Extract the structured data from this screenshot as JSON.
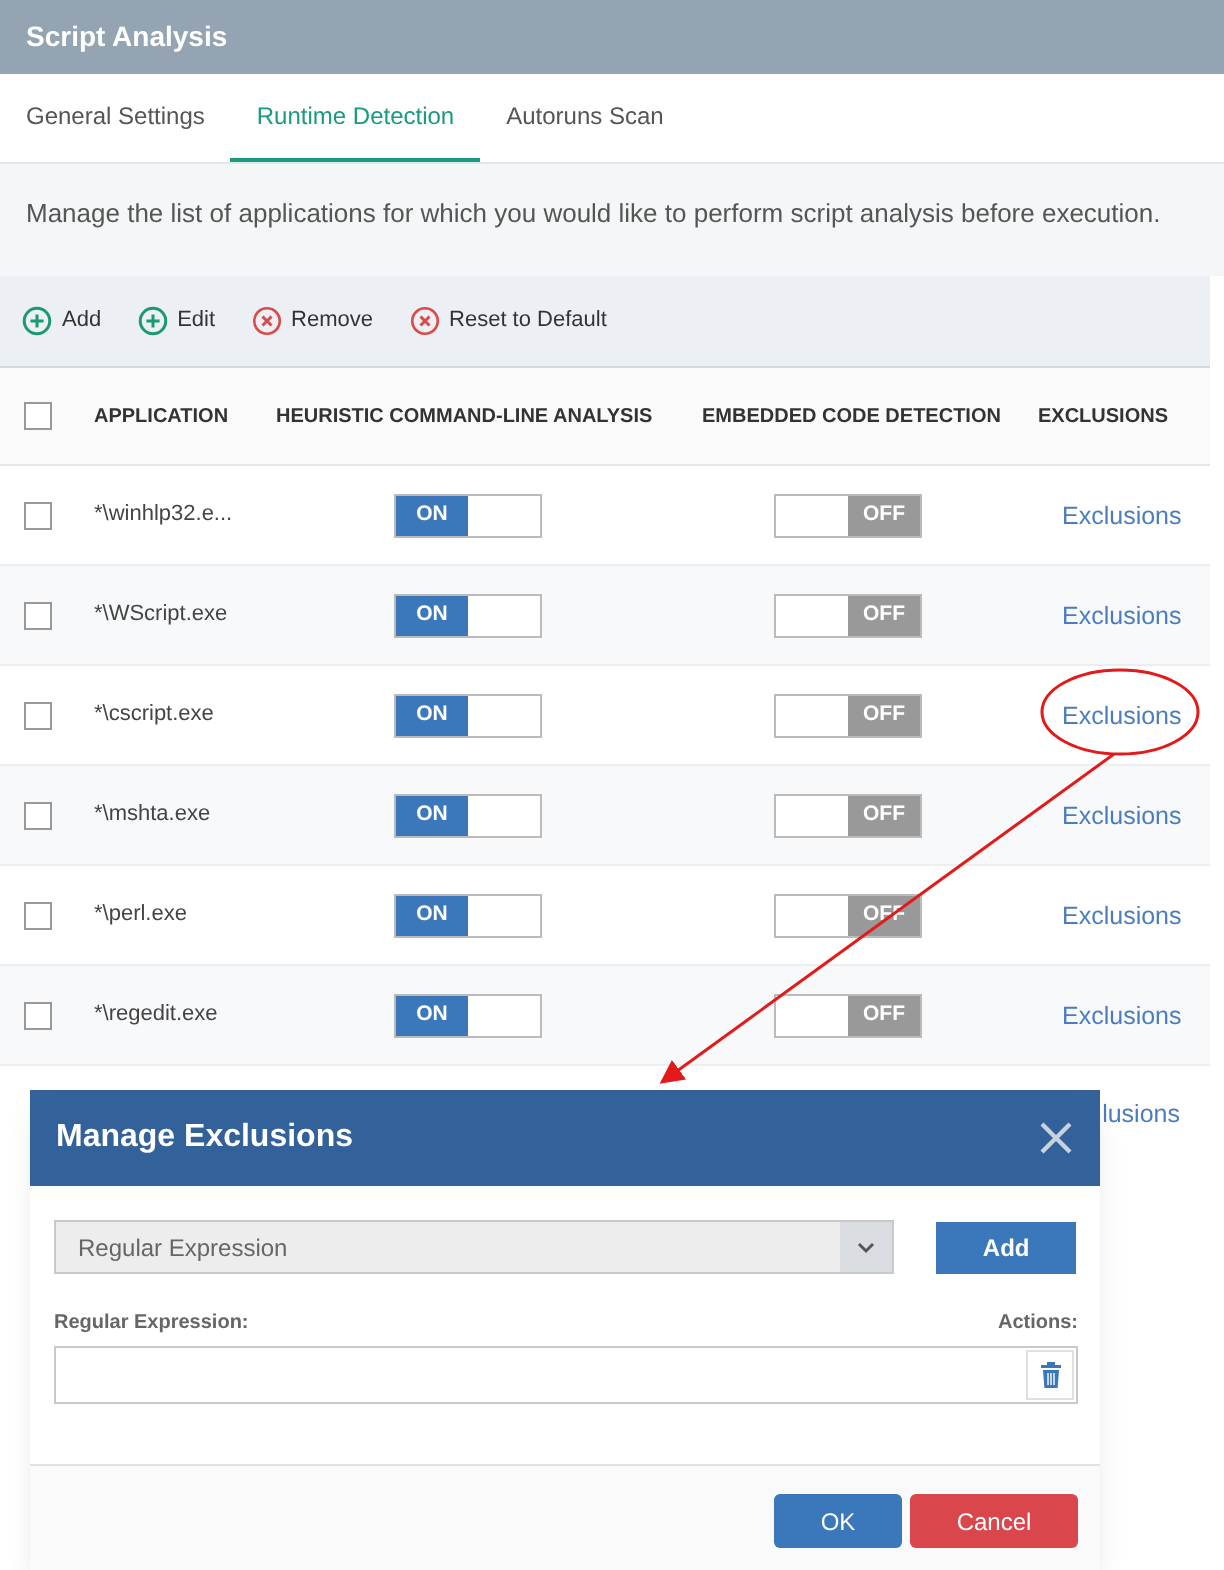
{
  "window": {
    "title": "Script Analysis"
  },
  "tabs": [
    {
      "label": "General Settings",
      "selected": false
    },
    {
      "label": "Runtime Detection",
      "selected": true
    },
    {
      "label": "Autoruns Scan",
      "selected": false
    }
  ],
  "description": "Manage the list of applications for which you would like to perform script analysis before execution.",
  "toolbar": [
    {
      "label": "Add",
      "kind": "add"
    },
    {
      "label": "Edit",
      "kind": "add"
    },
    {
      "label": "Remove",
      "kind": "remove"
    },
    {
      "label": "Reset to Default",
      "kind": "remove"
    }
  ],
  "table": {
    "select_all": {
      "checked": false
    },
    "columns": [
      "APPLICATION",
      "HEURISTIC COMMAND-LINE ANALYSIS",
      "EMBEDDED CODE DETECTION",
      "EXCLUSIONS"
    ],
    "rows": [
      {
        "checked": false,
        "application": "*\\winhlp32.e...",
        "heuristic": {
          "label": "ON",
          "on": true
        },
        "embedded": {
          "label": "OFF",
          "on": false
        },
        "exclusions": "Exclusions"
      },
      {
        "checked": false,
        "application": "*\\WScript.exe",
        "heuristic": {
          "label": "ON",
          "on": true
        },
        "embedded": {
          "label": "OFF",
          "on": false
        },
        "exclusions": "Exclusions"
      },
      {
        "checked": false,
        "application": "*\\cscript.exe",
        "heuristic": {
          "label": "ON",
          "on": true
        },
        "embedded": {
          "label": "OFF",
          "on": false
        },
        "exclusions": "Exclusions"
      },
      {
        "checked": false,
        "application": "*\\mshta.exe",
        "heuristic": {
          "label": "ON",
          "on": true
        },
        "embedded": {
          "label": "OFF",
          "on": false
        },
        "exclusions": "Exclusions"
      },
      {
        "checked": false,
        "application": "*\\perl.exe",
        "heuristic": {
          "label": "ON",
          "on": true
        },
        "embedded": {
          "label": "OFF",
          "on": false
        },
        "exclusions": "Exclusions"
      },
      {
        "checked": false,
        "application": "*\\regedit.exe",
        "heuristic": {
          "label": "ON",
          "on": true
        },
        "embedded": {
          "label": "OFF",
          "on": false
        },
        "exclusions": "Exclusions"
      }
    ],
    "partial_row": {
      "exclusions": "lusions"
    }
  },
  "dialog": {
    "title": "Manage Exclusions",
    "type_select": {
      "value": "Regular Expression"
    },
    "add_button": "Add",
    "field_label": "Regular Expression:",
    "actions_label": "Actions:",
    "buttons": [
      {
        "label": "OK",
        "kind": "primary"
      },
      {
        "label": "Cancel",
        "kind": "danger"
      }
    ]
  }
}
